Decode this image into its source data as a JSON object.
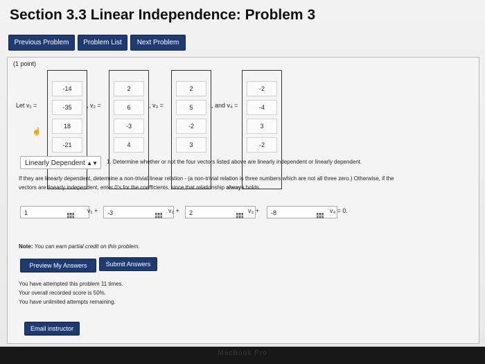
{
  "page_title": "Section 3.3 Linear Independence: Problem 3",
  "nav": {
    "previous": "Previous Problem",
    "list": "Problem List",
    "next": "Next Problem"
  },
  "problem": {
    "points": "(1 point)",
    "vectors": {
      "v1": [
        "-14",
        "-35",
        "18",
        "-21"
      ],
      "v2": [
        "2",
        "6",
        "-3",
        "4"
      ],
      "v3": [
        "2",
        "5",
        "-2",
        "3"
      ],
      "v4": [
        "-2",
        "-4",
        "3",
        "-2"
      ]
    },
    "labels": {
      "let_v1": "Let v₁ =",
      "v2": ", v₂ =",
      "v3": ", v₃ =",
      "and_v4": ", and v₄ ="
    },
    "dropdown_value": "Linearly Dependent",
    "question": "1. Determine whether or not the four vectors listed above are linearly independent or linearly dependent.",
    "instruction_a": "If they are linearly dependent, determine a non-trivial linear relation - (a non-trivial relation is three numbers which are not all three zero.) Otherwise, if the",
    "instruction_b_pre": "vectors are linearly independent, enter 0's for the coefficients, since that relationship ",
    "instruction_b_bold": "always",
    "instruction_b_post": " holds.",
    "coefficients": [
      "1",
      "-3",
      "2",
      "-8"
    ],
    "relation": {
      "v1": "v₁ +",
      "v2": "v₂ +",
      "v3": "v₃ +",
      "v4": "v₄ = 0."
    },
    "note_label": "Note:",
    "note_text": " You can earn partial credit on this problem.",
    "preview_button": "Preview My Answers",
    "submit_button": "Submit Answers",
    "attempted": "You have attempted this problem 11 times.",
    "score": "Your overall recorded score is 50%.",
    "remaining": "You have unlimited attempts remaining.",
    "email_button": "Email instructor"
  },
  "device_brand": "MacBook Pro"
}
